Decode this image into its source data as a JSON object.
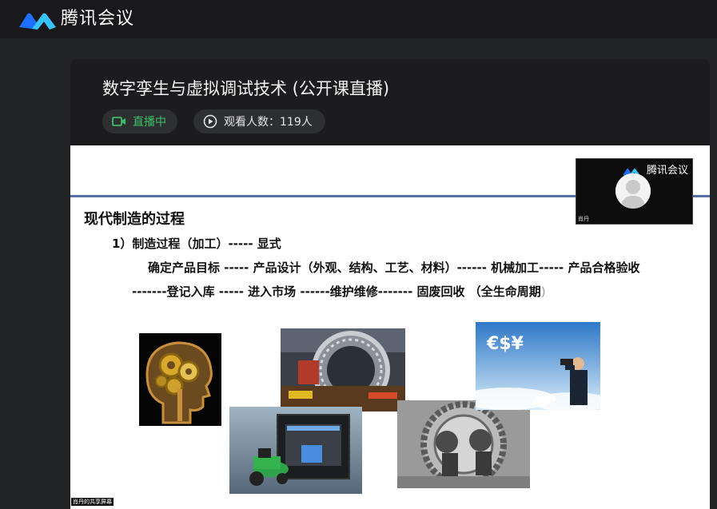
{
  "app": {
    "title": "腾讯会议",
    "brand_colors": [
      "#1e6fff",
      "#37c4ff"
    ]
  },
  "live": {
    "title": "数字孪生与虚拟调试技术 (公开课直播)",
    "status_label": "直播中",
    "status_color": "#3bc06a",
    "viewers_label": "观看人数：119人"
  },
  "slide": {
    "heading": "现代制造的过程",
    "subheading": "1）制造过程（加工）-----  显式",
    "line1": "确定产品目标  -----  产品设计（外观、结构、工艺、材料）------ 机械加工----- 产品合格验收",
    "line2": "-------登记入库 ----- 进入市场  ------维护维修------- 固废回收    （全生命周期",
    "line2_tail": ")",
    "images": [
      {
        "name": "gears-in-head-image"
      },
      {
        "name": "large-machinery-image"
      },
      {
        "name": "3d-printer-image"
      },
      {
        "name": "workers-in-gear-image"
      },
      {
        "name": "businessman-binoculars-image",
        "text": "€$¥"
      }
    ],
    "share_label": "肖丹的共享屏幕"
  },
  "camera": {
    "brand": "腾讯会议",
    "participant": "肖丹"
  },
  "icons": {
    "live": "video-camera-icon",
    "viewers": "play-circle-icon",
    "logo": "tencent-meeting-logo-icon",
    "avatar": "user-avatar-icon"
  }
}
